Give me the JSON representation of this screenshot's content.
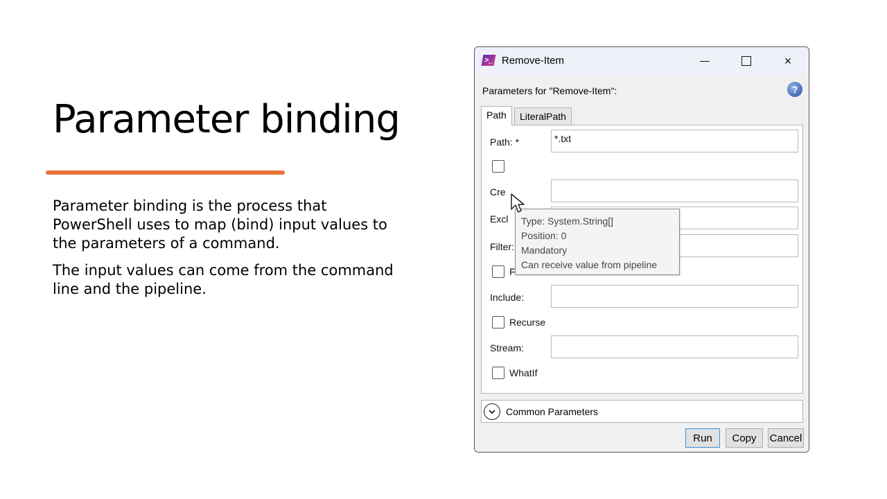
{
  "slide": {
    "title": "Parameter binding",
    "accent_color": "#e8743b",
    "paragraphs": [
      "Parameter binding is the process that PowerShell uses to map (bind) input values to the parameters of a command.",
      "The input values can come from the command line and the pipeline."
    ]
  },
  "window": {
    "title": "Remove-Item",
    "app_icon": "powershell-icon",
    "controls": {
      "minimize": "minimize-icon",
      "maximize": "maximize-icon",
      "close": "×"
    },
    "params_header": "Parameters for \"Remove-Item\":",
    "help_label": "?",
    "tabs": [
      {
        "label": "Path",
        "active": true
      },
      {
        "label": "LiteralPath",
        "active": false
      }
    ],
    "fields": {
      "path_label": "Path: *",
      "path_value": "*.txt",
      "credential_label": "Cre",
      "exclude_label": "Excl",
      "filter_label": "Filter:",
      "force_label": "Force",
      "include_label": "Include:",
      "recurse_label": "Recurse",
      "stream_label": "Stream:",
      "whatif_label": "WhatIf"
    },
    "tooltip": {
      "line1": "Type: System.String[]",
      "line2": "Position: 0",
      "line3": "Mandatory",
      "line4": "Can receive value from pipeline"
    },
    "common_parameters": "Common Parameters",
    "buttons": {
      "run": "Run",
      "copy": "Copy",
      "cancel": "Cancel"
    }
  }
}
